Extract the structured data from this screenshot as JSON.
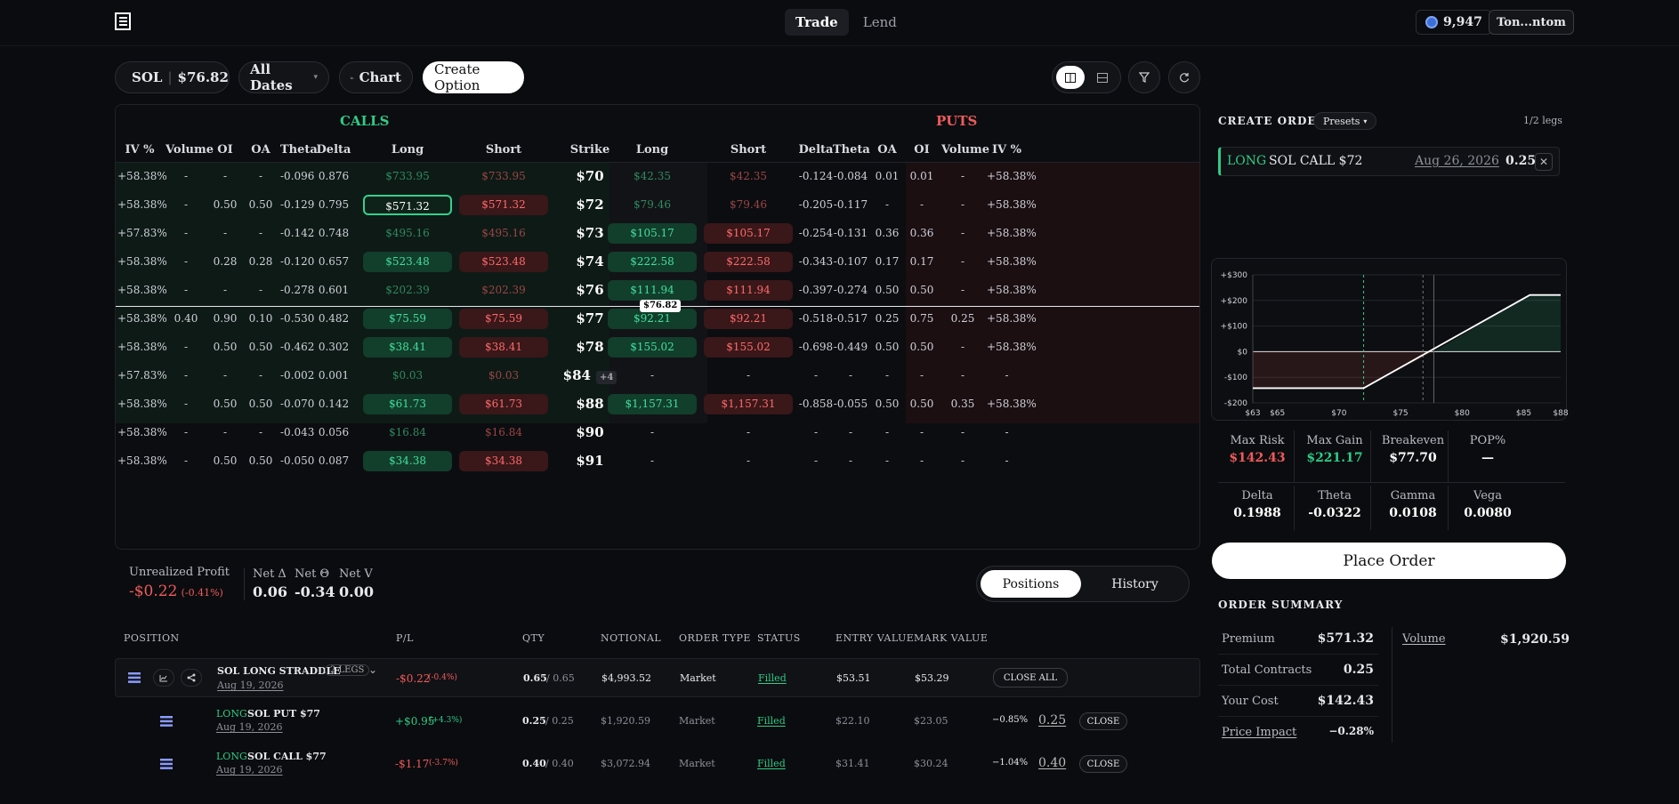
{
  "nav": {
    "tabs": [
      "Trade",
      "Lend"
    ],
    "balance": "9,947",
    "wallet": "Ton...ntom"
  },
  "toolbar": {
    "asset": "SOL",
    "price": "$76.82",
    "dates": "All Dates",
    "chart": "Chart",
    "create": "Create Option"
  },
  "chain": {
    "calls_title": "CALLS",
    "puts_title": "PUTS",
    "headers": [
      "IV %",
      "Volume",
      "OI",
      "OA",
      "Theta",
      "Delta",
      "Long",
      "Short",
      "Strike",
      "Long",
      "Short",
      "Delta",
      "Theta",
      "OA",
      "OI",
      "Volume",
      "IV %"
    ],
    "spot_tag": "$76.82",
    "rows": [
      [
        "+58.38%",
        "-",
        "-",
        "-",
        "-0.096",
        "0.876",
        "$733.95",
        "$733.95",
        "$70",
        "",
        "$42.35",
        "$42.35",
        "-0.124",
        "-0.084",
        "0.01",
        "0.01",
        "-",
        "+58.38%"
      ],
      [
        "+58.38%",
        "-",
        "0.50",
        "0.50",
        "-0.129",
        "0.795",
        "$571.32",
        "$571.32",
        "$72",
        "",
        "$79.46",
        "$79.46",
        "-0.205",
        "-0.117",
        "-",
        "-",
        "-",
        "+58.38%"
      ],
      [
        "+57.83%",
        "-",
        "-",
        "-",
        "-0.142",
        "0.748",
        "$495.16",
        "$495.16",
        "$73",
        "",
        "$105.17",
        "$105.17",
        "-0.254",
        "-0.131",
        "0.36",
        "0.36",
        "-",
        "+58.38%"
      ],
      [
        "+58.38%",
        "-",
        "0.28",
        "0.28",
        "-0.120",
        "0.657",
        "$523.48",
        "$523.48",
        "$74",
        "",
        "$222.58",
        "$222.58",
        "-0.343",
        "-0.107",
        "0.17",
        "0.17",
        "-",
        "+58.38%"
      ],
      [
        "+58.38%",
        "-",
        "-",
        "-",
        "-0.278",
        "0.601",
        "$202.39",
        "$202.39",
        "$76",
        "",
        "$111.94",
        "$111.94",
        "-0.397",
        "-0.274",
        "0.50",
        "0.50",
        "-",
        "+58.38%"
      ],
      [
        "+58.38%",
        "0.40",
        "0.90",
        "0.10",
        "-0.530",
        "0.482",
        "$75.59",
        "$75.59",
        "$77",
        "",
        "$92.21",
        "$92.21",
        "-0.518",
        "-0.517",
        "0.25",
        "0.75",
        "0.25",
        "+58.38%"
      ],
      [
        "+58.38%",
        "-",
        "0.50",
        "0.50",
        "-0.462",
        "0.302",
        "$38.41",
        "$38.41",
        "$78",
        "",
        "$155.02",
        "$155.02",
        "-0.698",
        "-0.449",
        "0.50",
        "0.50",
        "-",
        "+58.38%"
      ],
      [
        "+57.83%",
        "-",
        "-",
        "-",
        "-0.002",
        "0.001",
        "$0.03",
        "$0.03",
        "$84",
        "+4",
        "-",
        "-",
        "-",
        "-",
        "-",
        "-",
        "-",
        "-"
      ],
      [
        "+58.38%",
        "-",
        "0.50",
        "0.50",
        "-0.070",
        "0.142",
        "$61.73",
        "$61.73",
        "$88",
        "",
        "$1,157.31",
        "$1,157.31",
        "-0.858",
        "-0.055",
        "0.50",
        "0.50",
        "0.35",
        "+58.38%"
      ],
      [
        "+58.38%",
        "-",
        "-",
        "-",
        "-0.043",
        "0.056",
        "$16.84",
        "$16.84",
        "$90",
        "",
        "-",
        "-",
        "-",
        "-",
        "-",
        "-",
        "-",
        "-"
      ],
      [
        "+58.38%",
        "-",
        "0.50",
        "0.50",
        "-0.050",
        "0.087",
        "$34.38",
        "$34.38",
        "$91",
        "",
        "-",
        "-",
        "-",
        "-",
        "-",
        "-",
        "-",
        "-"
      ]
    ]
  },
  "order": {
    "title": "CREATE ORDER",
    "presets": "Presets",
    "legs": "1/2 legs",
    "leg_side": "LONG",
    "leg_name": "SOL CALL $72",
    "leg_date": "Aug 26, 2026",
    "leg_qty": "0.25",
    "place": "Place Order",
    "stats": [
      {
        "label": "Max Risk",
        "value": "$142.43",
        "color": "red"
      },
      {
        "label": "Max Gain",
        "value": "$221.17",
        "color": "green"
      },
      {
        "label": "Breakeven",
        "value": "$77.70",
        "color": "white"
      },
      {
        "label": "POP%",
        "value": "—",
        "color": "white"
      }
    ],
    "greeks": [
      {
        "label": "Delta",
        "value": "0.1988"
      },
      {
        "label": "Theta",
        "value": "-0.0322"
      },
      {
        "label": "Gamma",
        "value": "0.0108"
      },
      {
        "label": "Vega",
        "value": "0.0080"
      }
    ],
    "summary_title": "ORDER SUMMARY",
    "summary": [
      {
        "label": "Premium",
        "value": "$571.32"
      },
      {
        "label": "Total Contracts",
        "value": "0.25"
      },
      {
        "label": "Your Cost",
        "value": "$142.43"
      },
      {
        "label": "Price Impact",
        "value": "−0.28%"
      }
    ],
    "volume_label": "Volume",
    "volume_value": "$1,920.59"
  },
  "payoff": {
    "ylabels": [
      "+$300",
      "+$200",
      "+$100",
      "$0",
      "-$100",
      "-$200"
    ],
    "xlabels": [
      "$63",
      "$65",
      "$70",
      "$75",
      "$80",
      "$85",
      "$88"
    ],
    "chart_data": {
      "type": "line",
      "x": [
        63,
        72,
        85.5,
        88
      ],
      "y": [
        -142.43,
        -142.43,
        221.17,
        221.17
      ],
      "xlim": [
        63,
        88
      ],
      "ylim": [
        -200,
        300
      ],
      "markers": {
        "strike": 72,
        "breakeven": 77.7,
        "spot": 76.82
      }
    }
  },
  "pnl": {
    "label": "Unrealized Profit",
    "value": "-$0.22",
    "pct": "(-0.41%)",
    "net_delta_label": "Net Δ",
    "net_delta": "0.06",
    "net_theta_label": "Net Θ",
    "net_theta": "-0.34",
    "net_vega_label": "Net V",
    "net_vega": "0.00"
  },
  "positions_tabs": [
    "Positions",
    "History"
  ],
  "positions": {
    "headers": [
      "POSITION",
      "P/L",
      "QTY",
      "NOTIONAL",
      "ORDER TYPE",
      "STATUS",
      "ENTRY VALUE",
      "MARK VALUE"
    ],
    "group": {
      "name": "SOL LONG STRADDLE",
      "legs": "2 LEGS",
      "date": "Aug 19, 2026",
      "pl": "-$0.22",
      "pl_pct": "(-0.4%)",
      "qty": "0.65",
      "qty_total": "/ 0.65",
      "notional": "$4,993.52",
      "type": "Market",
      "status": "Filled",
      "entry": "$53.51",
      "mark": "$53.29",
      "action": "CLOSE ALL"
    },
    "legs": [
      {
        "side": "LONG",
        "name": "SOL PUT $77",
        "date": "Aug 19, 2026",
        "pl": "+$0.95",
        "pl_pct": "(+4.3%)",
        "qty": "0.25",
        "qty_total": "/ 0.25",
        "notional": "$1,920.59",
        "type": "Market",
        "status": "Filled",
        "entry": "$22.10",
        "mark": "$23.05",
        "chg": "−0.85%",
        "close_qty": "0.25",
        "action": "CLOSE"
      },
      {
        "side": "LONG",
        "name": "SOL CALL $77",
        "date": "Aug 19, 2026",
        "pl": "-$1.17",
        "pl_pct": "(-3.7%)",
        "qty": "0.40",
        "qty_total": "/ 0.40",
        "notional": "$3,072.94",
        "type": "Market",
        "status": "Filled",
        "entry": "$31.41",
        "mark": "$30.24",
        "chg": "−1.04%",
        "close_qty": "0.40",
        "action": "CLOSE"
      }
    ]
  }
}
